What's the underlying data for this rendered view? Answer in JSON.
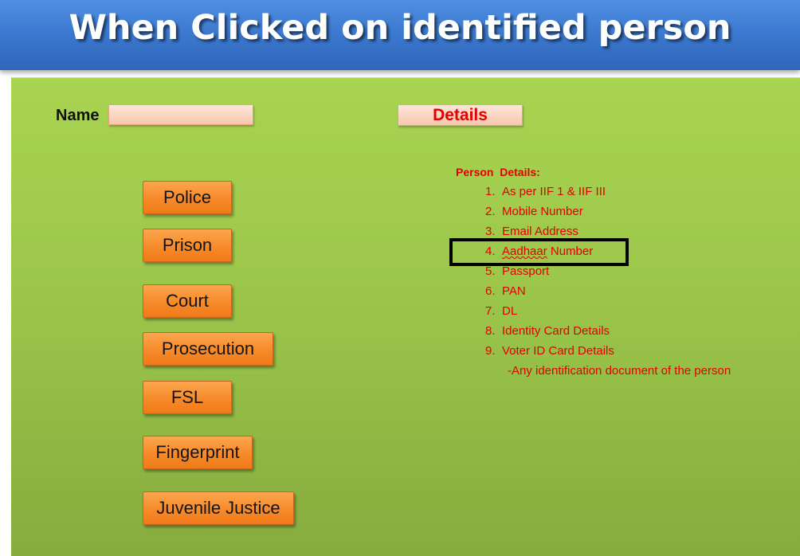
{
  "title": "When Clicked on identified person",
  "form": {
    "name_label": "Name",
    "name_value": "",
    "details_label": "Details"
  },
  "buttons": {
    "police": "Police",
    "prison": "Prison",
    "court": "Court",
    "prosecution": "Prosecution",
    "fsl": "FSL",
    "fingerprint": "Fingerprint",
    "juvenile_justice": "Juvenile Justice"
  },
  "details": {
    "heading": "Person  Details:",
    "items": [
      {
        "num": "1.",
        "text": "As per IIF 1 & IIF III"
      },
      {
        "num": "2.",
        "text": "Mobile Number"
      },
      {
        "num": "3.",
        "text": "Email Address"
      },
      {
        "num": "4.",
        "text_a": "Aadhaar",
        "text_b": " Number"
      },
      {
        "num": "5.",
        "text": "Passport"
      },
      {
        "num": "6.",
        "text": "PAN"
      },
      {
        "num": "7.",
        "text": "DL"
      },
      {
        "num": "8.",
        "text": "Identity Card Details"
      },
      {
        "num": "9.",
        "text": "Voter ID Card Details"
      }
    ],
    "note": "-Any identification document of the person"
  },
  "colors": {
    "title_bar": "#3b78cf",
    "panel_green": "#9bc64a",
    "button_orange": "#f78a2a",
    "text_red": "#e00000",
    "field_peach": "#f9d3bd"
  }
}
